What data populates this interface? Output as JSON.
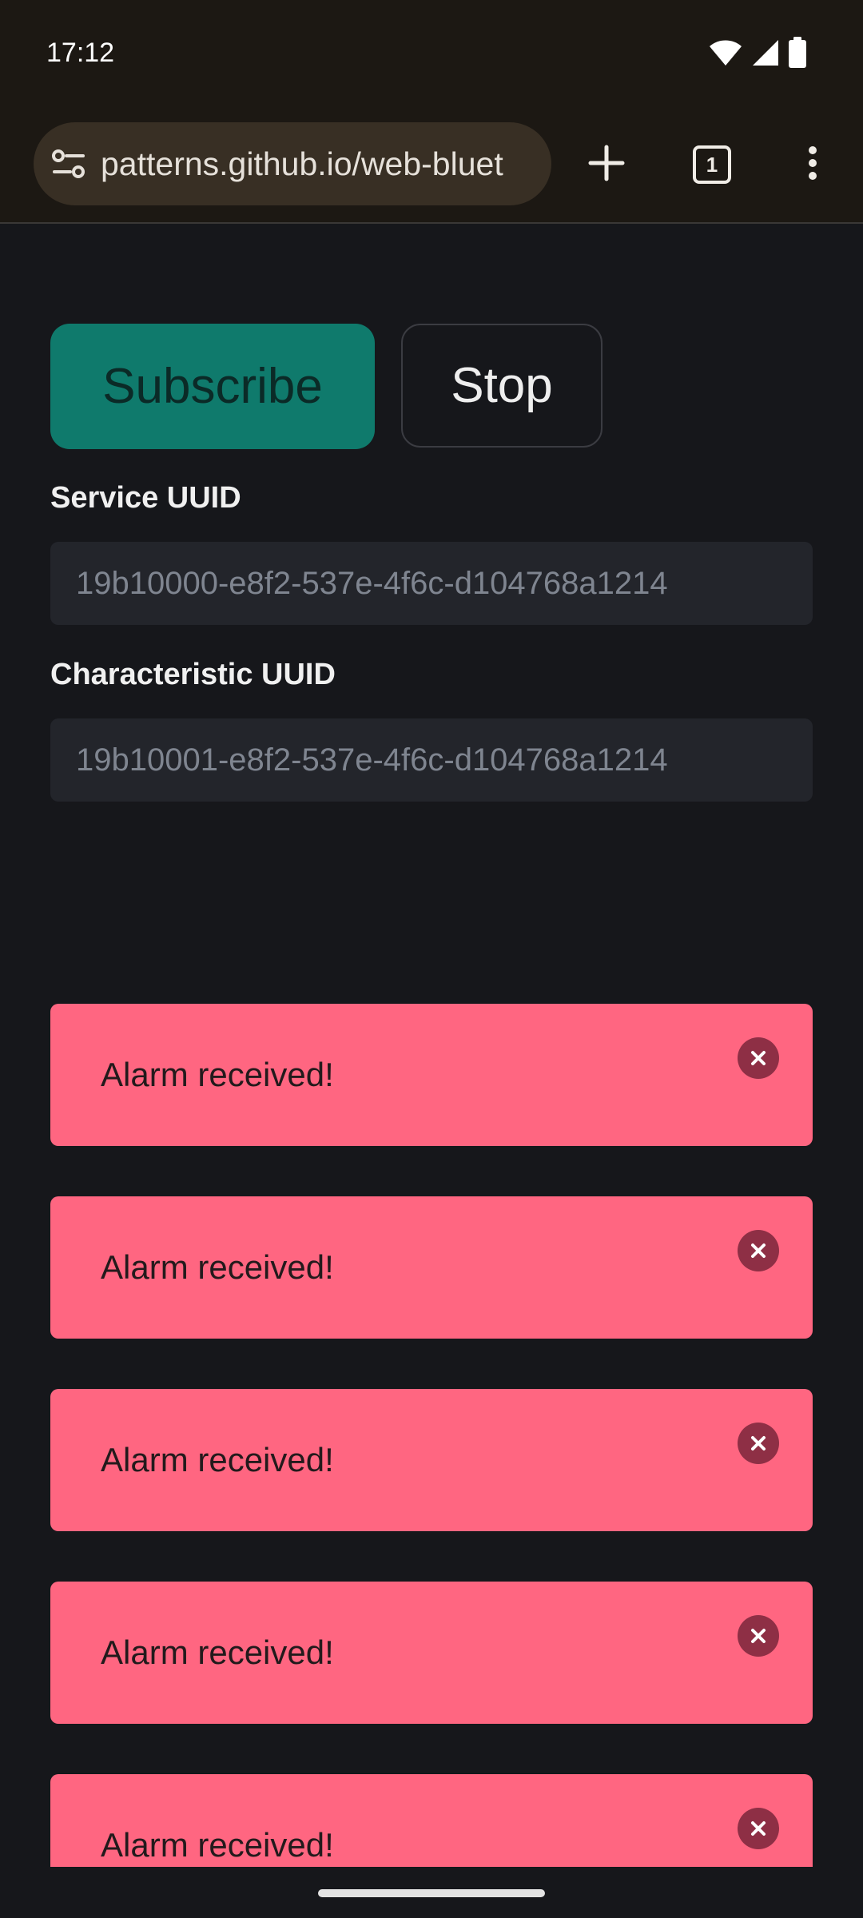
{
  "status_bar": {
    "time": "17:12",
    "icons": [
      "wifi-icon",
      "cellular-signal-icon",
      "battery-icon"
    ]
  },
  "browser": {
    "url": "patterns.github.io/web-bluet",
    "tab_count": "1",
    "icons": [
      "site-settings-icon",
      "new-tab-icon",
      "tab-switcher-icon",
      "more-menu-icon"
    ]
  },
  "page": {
    "subscribe_label": "Subscribe",
    "stop_label": "Stop",
    "service_label": "Service UUID",
    "service_placeholder": "19b10000-e8f2-537e-4f6c-d104768a1214",
    "service_value": "",
    "characteristic_label": "Characteristic UUID",
    "characteristic_placeholder": "19b10001-e8f2-537e-4f6c-d104768a1214",
    "characteristic_value": ""
  },
  "alerts": [
    {
      "message": "Alarm received!",
      "close_icon": "close-icon"
    },
    {
      "message": "Alarm received!",
      "close_icon": "close-icon"
    },
    {
      "message": "Alarm received!",
      "close_icon": "close-icon"
    },
    {
      "message": "Alarm received!",
      "close_icon": "close-icon"
    },
    {
      "message": "Alarm received!",
      "close_icon": "close-icon"
    }
  ],
  "colors": {
    "background": "#16171b",
    "browser_chrome": "#1c1813",
    "url_pill": "#382f24",
    "subscribe_button": "#0f7a6c",
    "alert_background": "#ff6681",
    "alert_close": "#8e2f45",
    "input_background": "#23252b"
  }
}
